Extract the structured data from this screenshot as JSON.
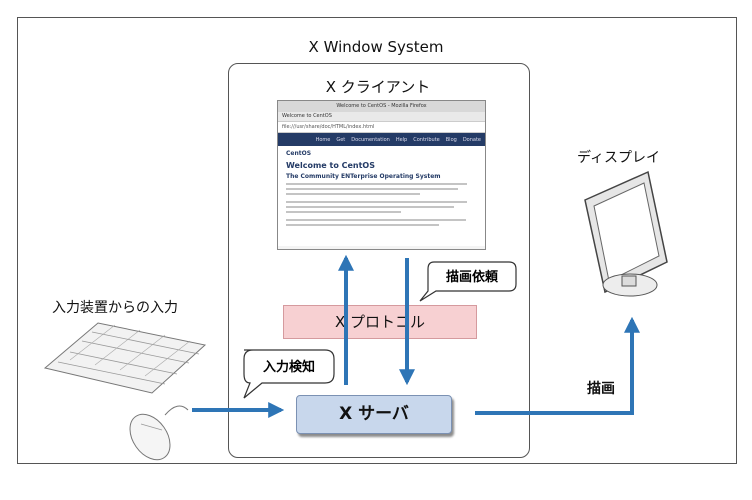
{
  "diagram": {
    "system_title": "X Window System",
    "client_title": "X クライアント",
    "protocol_label": "X プロトコル",
    "server_label": "X サーバ",
    "display_label": "ディスプレイ",
    "input_label": "入力装置からの入力",
    "input_detect": "入力検知",
    "draw_request": "描画依頼",
    "draw_label": "描画"
  },
  "browser": {
    "window_title": "Welcome to CentOS - Mozilla Firefox",
    "tab_label": "Welcome to CentOS",
    "url": "file:///usr/share/doc/HTML/index.html",
    "nav_items": [
      "Home",
      "Get",
      "Documentation",
      "Help",
      "Contribute",
      "Blog",
      "Donate"
    ],
    "logo_text": "CentOS",
    "heading": "Welcome to CentOS",
    "subheading": "The Community ENTerprise Operating System"
  },
  "colors": {
    "arrow": "#2e75b6",
    "protocol_fill": "#f7d0d2",
    "server_fill": "#c8d7ec"
  }
}
